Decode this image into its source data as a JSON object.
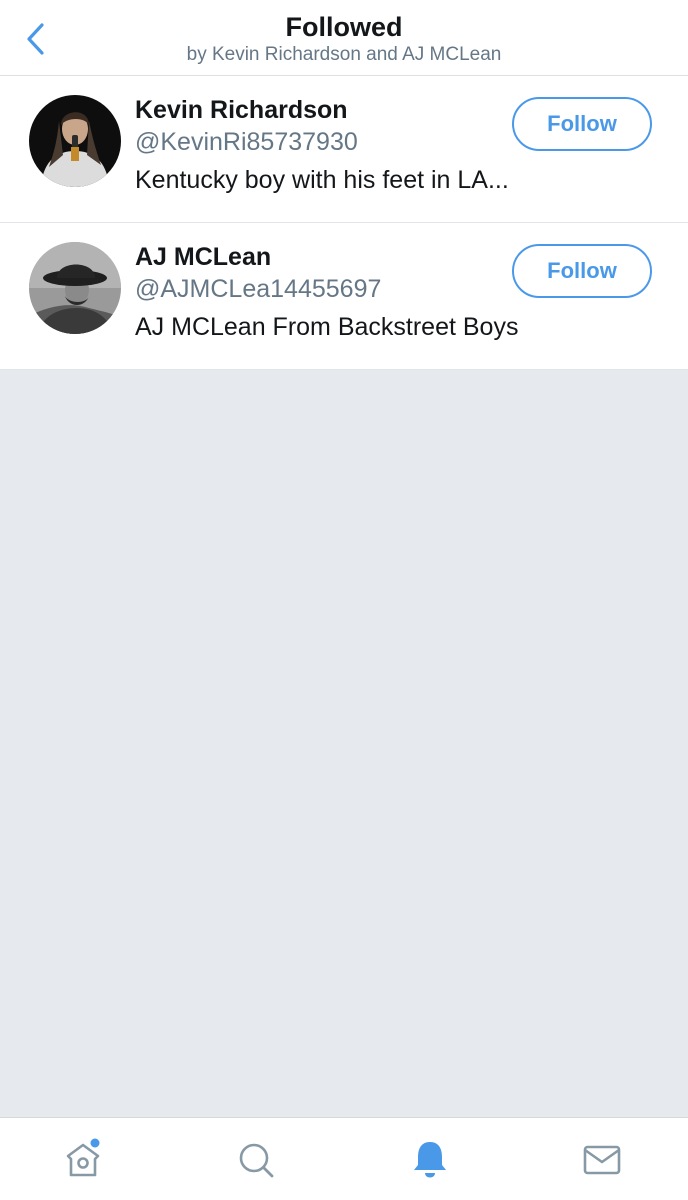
{
  "header": {
    "title": "Followed",
    "subtitle": "by Kevin Richardson and AJ MCLean",
    "back_icon": "chevron-left-icon"
  },
  "users": [
    {
      "name": "Kevin Richardson",
      "handle": "@KevinRi85737930",
      "bio": "Kentucky boy with his feet in LA...",
      "follow_label": "Follow"
    },
    {
      "name": "AJ MCLean",
      "handle": "@AJMCLea14455697",
      "bio": "AJ MCLean From Backstreet Boys",
      "follow_label": "Follow"
    }
  ],
  "tabbar": {
    "tabs": [
      {
        "icon": "home-icon",
        "has_notification_dot": true
      },
      {
        "icon": "search-icon"
      },
      {
        "icon": "bell-icon",
        "active": true
      },
      {
        "icon": "mail-icon"
      }
    ]
  },
  "colors": {
    "accent": "#4a99e9",
    "text_primary": "#14171a",
    "text_secondary": "#657786",
    "background": "#e6e9ed",
    "icon_inactive": "#8899a6"
  }
}
